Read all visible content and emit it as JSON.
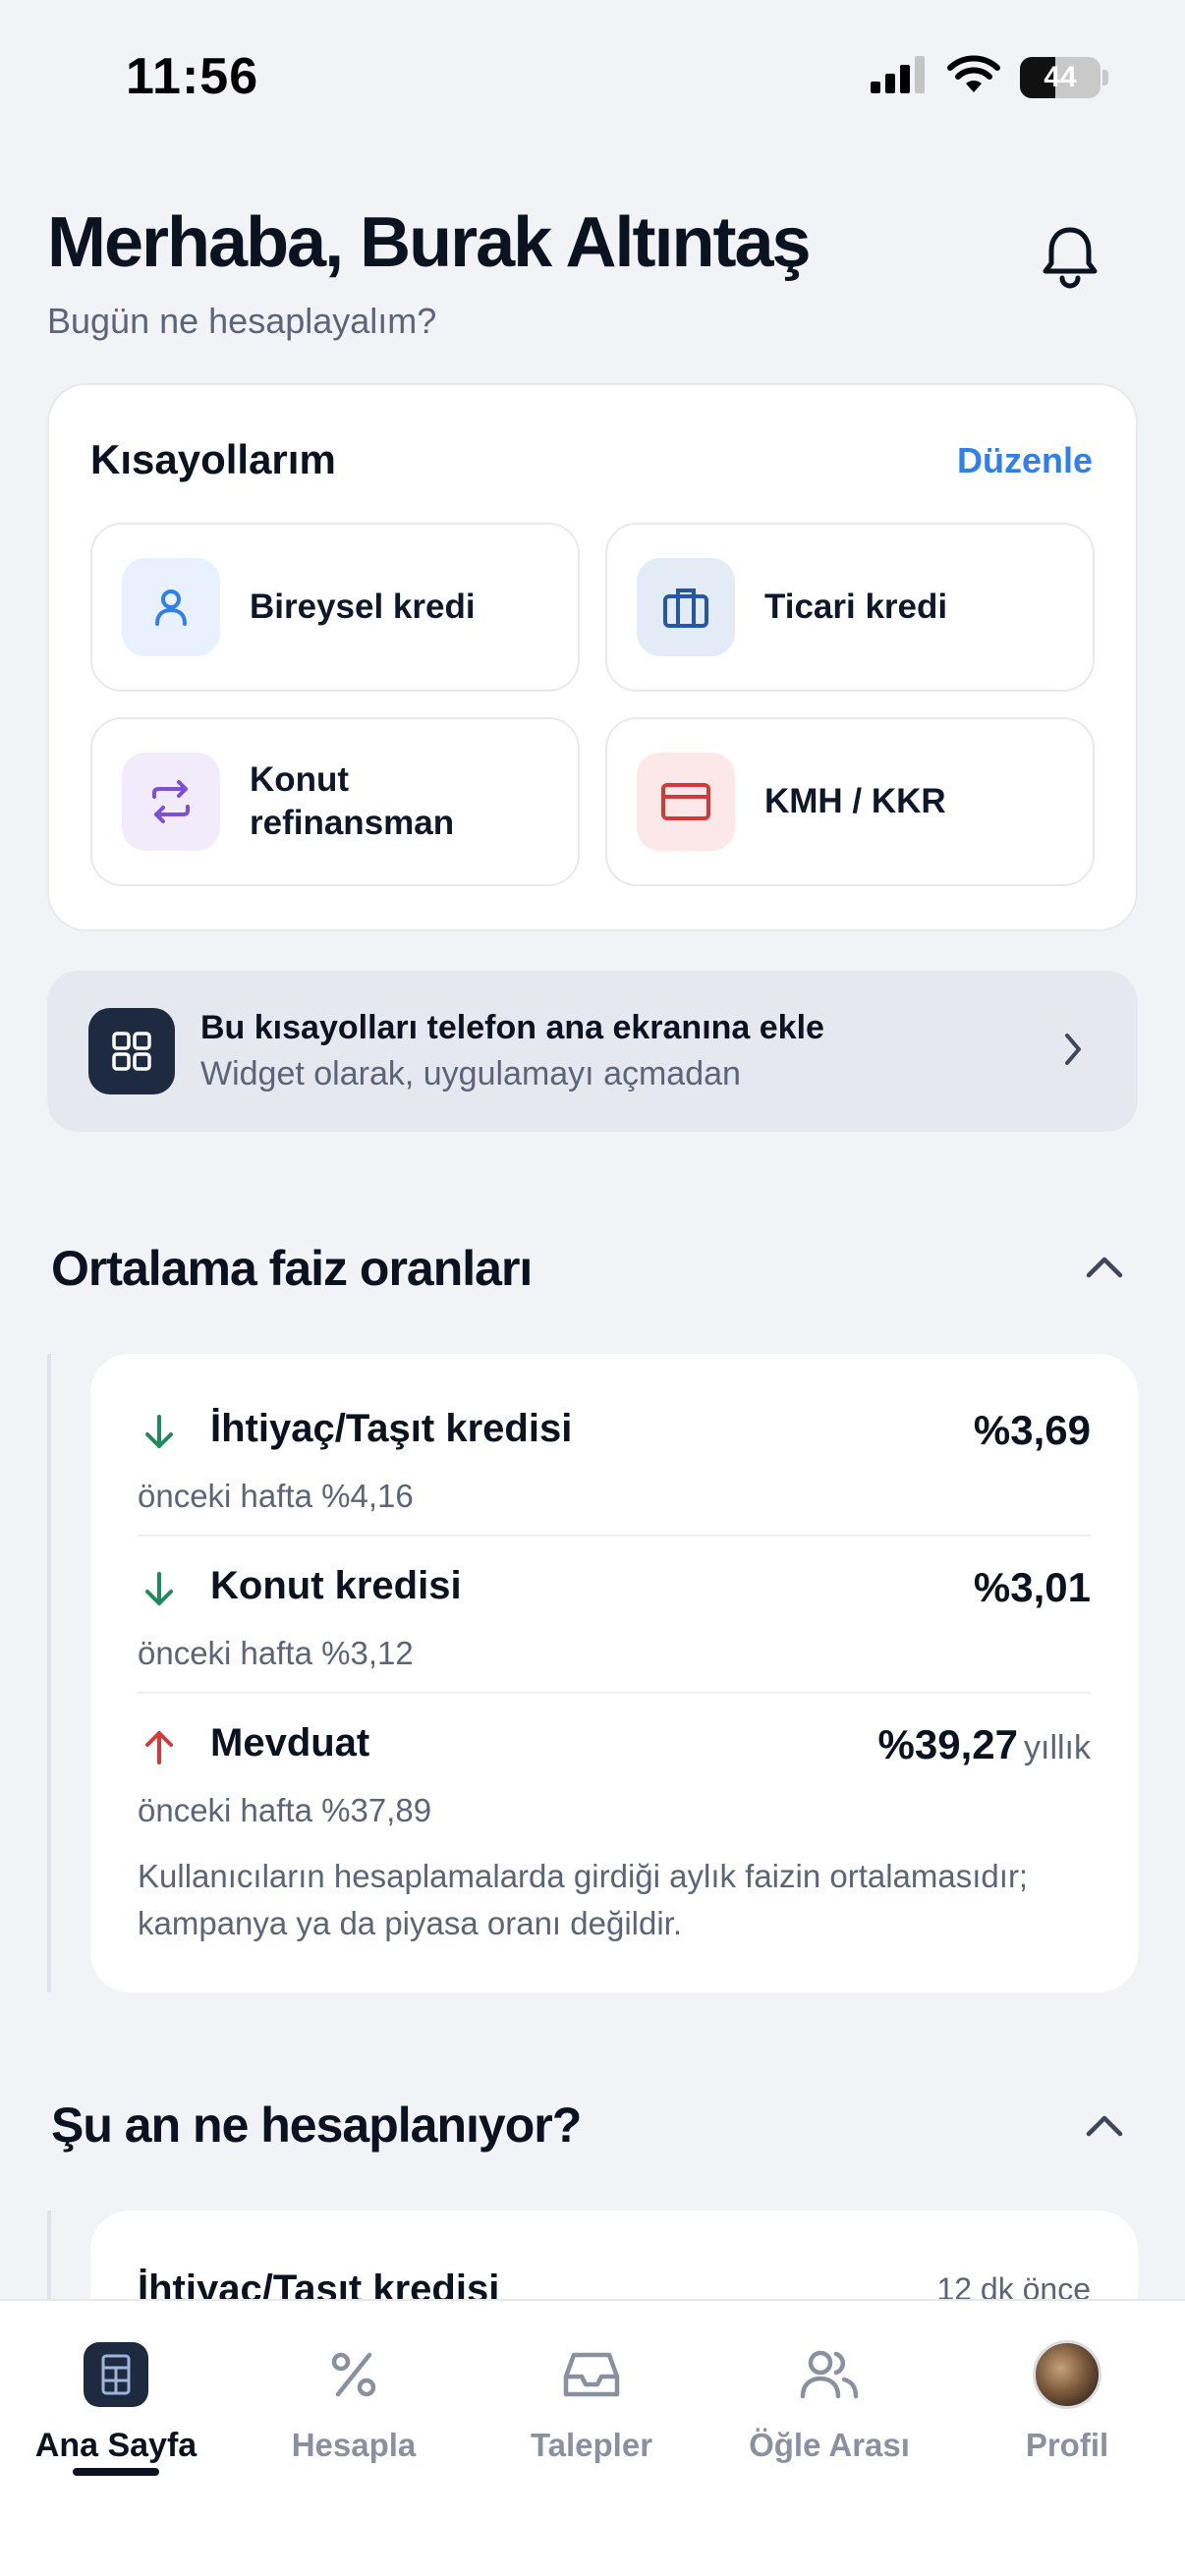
{
  "status_bar": {
    "time": "11:56",
    "battery": "44"
  },
  "header": {
    "greeting": "Merhaba, Burak Altıntaş",
    "subtitle": "Bugün ne hesaplayalım?"
  },
  "shortcuts": {
    "title": "Kısayollarım",
    "edit_label": "Düzenle",
    "items": [
      {
        "label": "Bireysel kredi",
        "icon": "user-icon",
        "color": "#2f80ed"
      },
      {
        "label": "Ticari kredi",
        "icon": "briefcase-icon",
        "color": "#2457a6"
      },
      {
        "label": "Konut refinansman",
        "icon": "swap-arrows-icon",
        "color": "#7c4ddf"
      },
      {
        "label": "KMH / KKR",
        "icon": "credit-card-icon",
        "color": "#d23a3a"
      }
    ]
  },
  "widget_banner": {
    "title": "Bu kısayolları telefon ana ekranına ekle",
    "subtitle": "Widget olarak, uygulamayı açmadan"
  },
  "rates": {
    "title": "Ortalama faiz oranları",
    "items": [
      {
        "name": "İhtiyaç/Taşıt kredisi",
        "value": "%3,69",
        "unit": "",
        "previous": "önceki hafta %4,16",
        "trend": "down"
      },
      {
        "name": "Konut kredisi",
        "value": "%3,01",
        "unit": "",
        "previous": "önceki hafta %3,12",
        "trend": "down"
      },
      {
        "name": "Mevduat",
        "value": "%39,27",
        "unit": "yıllık",
        "previous": "önceki hafta %37,89",
        "trend": "up"
      }
    ],
    "note": "Kullanıcıların hesaplamalarda girdiği aylık faizin ortalamasıdır; kampanya ya da piyasa oranı değildir."
  },
  "activity": {
    "title": "Şu an ne hesaplanıyor?",
    "first_item": {
      "name": "İhtiyaç/Taşıt kredisi",
      "time": "12 dk önce"
    }
  },
  "bottom_nav": {
    "items": [
      {
        "label": "Ana Sayfa",
        "active": true
      },
      {
        "label": "Hesapla",
        "active": false
      },
      {
        "label": "Talepler",
        "active": false
      },
      {
        "label": "Öğle Arası",
        "active": false
      },
      {
        "label": "Profil",
        "active": false
      }
    ]
  },
  "colors": {
    "accent": "#2f80ed",
    "trend_down": "#1f8a5b",
    "trend_up": "#d23a3a",
    "dark": "#1e2a40"
  }
}
